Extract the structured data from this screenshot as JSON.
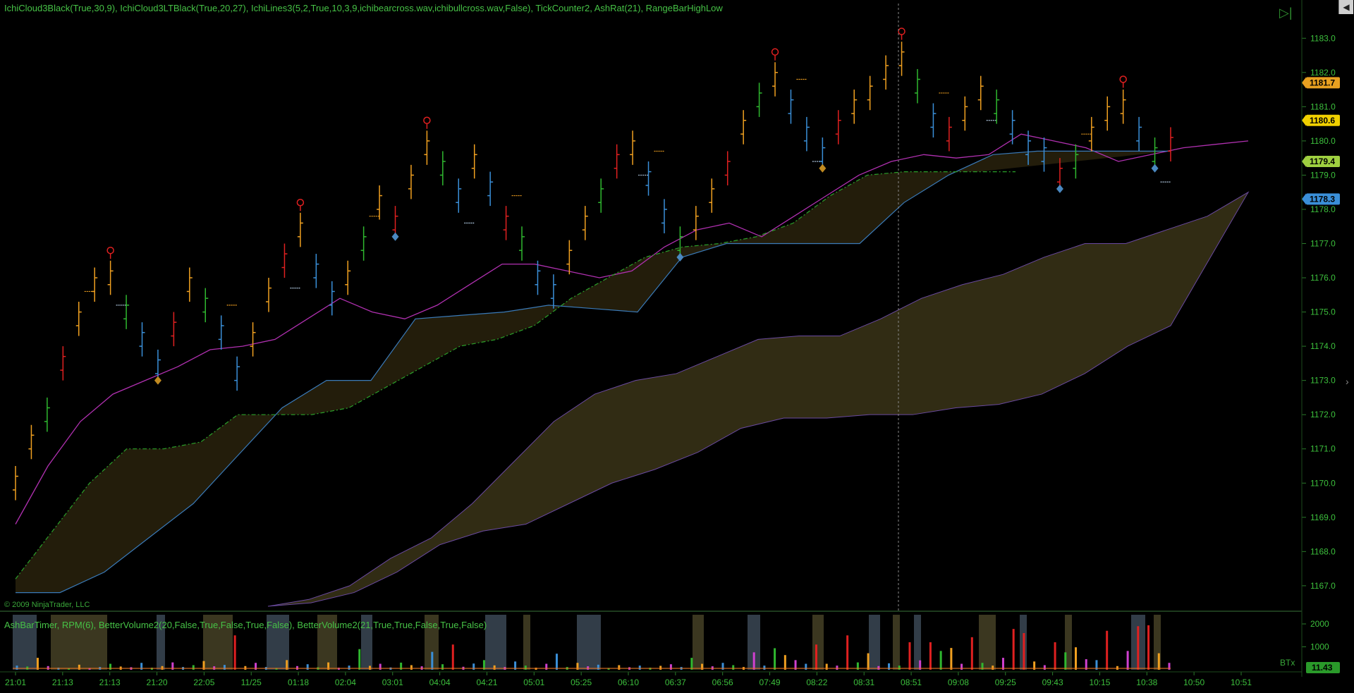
{
  "indicator_title": "IchiCloud3Black(True,30,9),  IchiCloud3LTBlack(True,20,27),  IchiLines3(5,2,True,10,3,9,ichibearcross.wav,ichibullcross.wav,False),  TickCounter2,  AshRat(21),  RangeBarHighLow",
  "volume_panel_title": "AshBarTimer,  RPM(6),  BetterVolume2(20,False,True,False,True,False),  BetterVolume2(21,True,True,False,True,False)",
  "copyright": "© 2009 NinjaTrader, LLC",
  "btx_label": "BTx",
  "scroll_glyph": "◀",
  "goto_end_glyph": "▷|",
  "edge_glyph": "›",
  "colors": {
    "background": "#000000",
    "axis_text": "#3cbf3c",
    "bull_bar": "#f0a020",
    "bear_bar": "#3a8fd8",
    "green_bar": "#2fb82f",
    "red_bar": "#e02020",
    "magenta_line": "#b030b0",
    "cloud": "#3a3418"
  },
  "chart_data": [
    {
      "type": "line",
      "title": "",
      "x_ticks": [
        "21:01",
        "21:13",
        "21:13",
        "21:20",
        "22:05",
        "11/25",
        "01:18",
        "02:04",
        "03:01",
        "04:04",
        "04:21",
        "05:01",
        "05:25",
        "06:10",
        "06:37",
        "06:56",
        "07:49",
        "08:22",
        "08:31",
        "08:51",
        "09:08",
        "09:25",
        "09:43",
        "10:15",
        "10:38",
        "10:50",
        "10:51"
      ],
      "y_ticks": [
        "1183.0",
        "1182.0",
        "1181.0",
        "1180.0",
        "1179.0",
        "1178.0",
        "1177.0",
        "1176.0",
        "1175.0",
        "1174.0",
        "1173.0",
        "1172.0",
        "1171.0",
        "1170.0",
        "1169.0",
        "1168.0",
        "1167.0"
      ],
      "ylim": [
        1166.4,
        1183.5
      ],
      "price_labels": [
        {
          "text": "1181.7",
          "value": 1181.7,
          "color": "#e8a020"
        },
        {
          "text": "1180.6",
          "value": 1180.6,
          "color": "#f0d000"
        },
        {
          "text": "1179.4",
          "value": 1179.4,
          "color": "#9fd040"
        },
        {
          "text": "1178.3",
          "value": 1178.3,
          "color": "#3a8fd8"
        }
      ],
      "series": [
        {
          "role": "price",
          "values": [
            1170.0,
            1171.2,
            1172.0,
            1173.5,
            1174.8,
            1175.8,
            1176.0,
            1175.0,
            1174.2,
            1173.4,
            1174.5,
            1175.8,
            1175.2,
            1174.4,
            1173.2,
            1174.2,
            1175.5,
            1176.5,
            1177.4,
            1176.2,
            1175.4,
            1176.0,
            1177.0,
            1178.2,
            1177.6,
            1178.8,
            1179.8,
            1179.2,
            1178.4,
            1179.4,
            1178.6,
            1177.6,
            1177.0,
            1176.0,
            1175.6,
            1176.6,
            1177.6,
            1178.4,
            1179.4,
            1179.8,
            1178.9,
            1177.8,
            1177.0,
            1177.6,
            1178.4,
            1179.2,
            1180.4,
            1181.2,
            1181.8,
            1181.0,
            1180.2,
            1179.6,
            1180.4,
            1181.0,
            1181.4,
            1182.0,
            1182.4,
            1181.6,
            1180.6,
            1180.2,
            1180.8,
            1181.4,
            1181.0,
            1180.4,
            1179.8,
            1179.6,
            1179.0,
            1179.4,
            1180.2,
            1180.8,
            1181.0,
            1180.2,
            1179.6,
            1179.9
          ]
        },
        {
          "role": "magenta",
          "values": [
            1168.8,
            1170.5,
            1171.8,
            1172.6,
            1173.0,
            1173.4,
            1173.9,
            1174.0,
            1174.2,
            1174.8,
            1175.4,
            1175.0,
            1174.8,
            1175.2,
            1175.8,
            1176.4,
            1176.4,
            1176.2,
            1176.0,
            1176.2,
            1176.9,
            1177.4,
            1177.6,
            1177.2,
            1177.8,
            1178.4,
            1179.0,
            1179.4,
            1179.6,
            1179.5,
            1179.6,
            1180.2,
            1180.0,
            1179.8,
            1179.4,
            1179.6,
            1179.8,
            1179.9,
            1180.0
          ]
        },
        {
          "role": "blue_kijun",
          "values": [
            1166.8,
            1166.8,
            1167.4,
            1168.4,
            1169.4,
            1170.8,
            1172.2,
            1173.0,
            1173.0,
            1174.8,
            1174.9,
            1175.0,
            1175.2,
            1175.1,
            1175.0,
            1176.6,
            1177.0,
            1177.0,
            1177.0,
            1177.0,
            1178.2,
            1179.0,
            1179.6,
            1179.7,
            1179.7,
            1179.7,
            1179.7
          ]
        },
        {
          "role": "green_dashdot",
          "values": [
            1167.2,
            1168.6,
            1170.0,
            1171.0,
            1171.0,
            1171.2,
            1172.0,
            1172.0,
            1172.0,
            1172.2,
            1172.8,
            1173.4,
            1174.0,
            1174.2,
            1174.6,
            1175.4,
            1176.0,
            1176.6,
            1176.9,
            1177.0,
            1177.2,
            1177.6,
            1178.4,
            1179.0,
            1179.1,
            1179.1,
            1179.1,
            1179.1
          ]
        },
        {
          "role": "long_cloud_upper",
          "values": [
            1166.4,
            1166.6,
            1167.0,
            1167.8,
            1168.4,
            1169.4,
            1170.6,
            1171.8,
            1172.6,
            1173.0,
            1173.2,
            1173.7,
            1174.2,
            1174.3,
            1174.3,
            1174.8,
            1175.4,
            1175.8,
            1176.1,
            1176.6,
            1177.0,
            1177.0,
            1177.4,
            1177.8,
            1178.5
          ]
        },
        {
          "role": "long_cloud_lower",
          "values": [
            1166.4,
            1166.5,
            1166.8,
            1167.4,
            1168.2,
            1168.6,
            1168.8,
            1169.4,
            1170.0,
            1170.4,
            1170.9,
            1171.6,
            1171.9,
            1171.9,
            1172.0,
            1172.0,
            1172.2,
            1172.3,
            1172.6,
            1173.2,
            1174.0,
            1174.6
          ]
        }
      ]
    },
    {
      "type": "bar",
      "title": "",
      "y_ticks": [
        "2000",
        "1000"
      ],
      "ylim": [
        0,
        2400
      ],
      "current_value_label": "11.43",
      "values": [
        180,
        140,
        520,
        160,
        90,
        60,
        220,
        80,
        120,
        260,
        140,
        110,
        300,
        90,
        160,
        320,
        120,
        200,
        380,
        150,
        210,
        1500,
        160,
        300,
        120,
        80,
        420,
        160,
        240,
        110,
        320,
        90,
        180,
        900,
        170,
        260,
        100,
        310,
        200,
        150,
        780,
        240,
        1100,
        130,
        270,
        420,
        190,
        120,
        360,
        180,
        90,
        260,
        700,
        120,
        300,
        150,
        220,
        80,
        200,
        110,
        180,
        90,
        170,
        240,
        120,
        520,
        260,
        150,
        300,
        200,
        120,
        760,
        180,
        940,
        640,
        420,
        260,
        1100,
        260,
        180,
        1500,
        320,
        720,
        160,
        280,
        180,
        1200,
        410,
        1200,
        820,
        950,
        260,
        1420,
        300,
        180,
        520,
        1780,
        1600,
        360,
        200,
        1200,
        760,
        980,
        460,
        420,
        1700,
        160,
        820,
        1900,
        1940,
        720,
        300
      ]
    }
  ]
}
